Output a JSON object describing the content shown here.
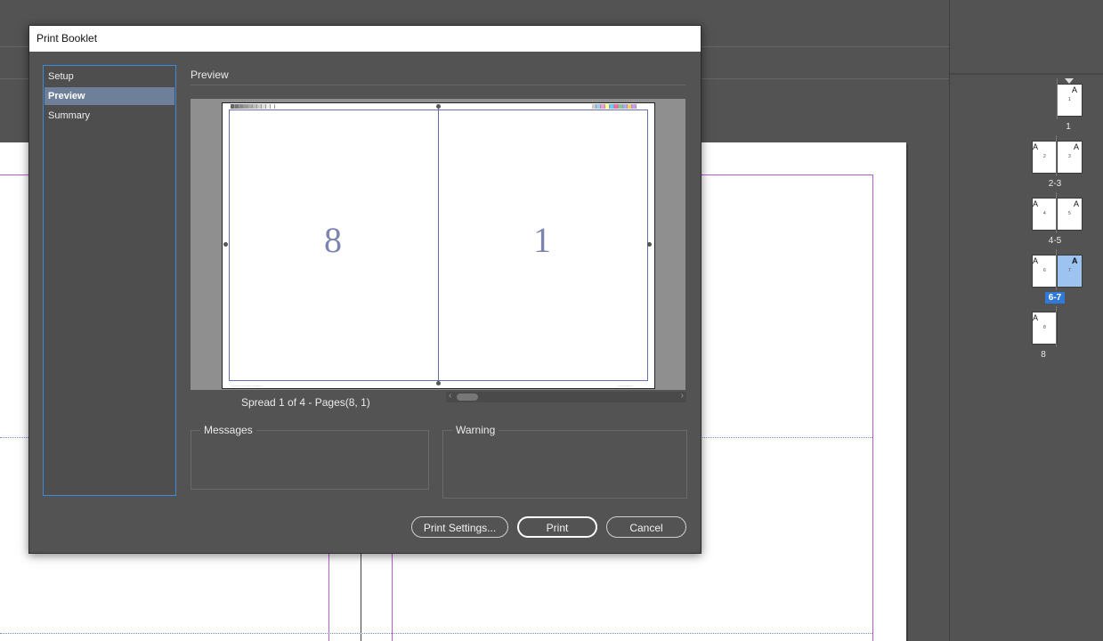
{
  "dialog": {
    "title": "Print Booklet",
    "sidebar": [
      {
        "label": "Setup",
        "selected": false
      },
      {
        "label": "Preview",
        "selected": true
      },
      {
        "label": "Summary",
        "selected": false
      }
    ],
    "section_title": "Preview",
    "preview": {
      "left_page": "8",
      "right_page": "1",
      "spread_info": "Spread 1 of 4 - Pages(8, 1)"
    },
    "messages_label": "Messages",
    "warning_label": "Warning",
    "buttons": {
      "print_settings": "Print Settings...",
      "print": "Print",
      "cancel": "Cancel"
    }
  },
  "pages_panel": {
    "master_letter": "A",
    "spreads": [
      {
        "label": "1",
        "selected": false
      },
      {
        "label": "2-3",
        "selected": false
      },
      {
        "label": "4-5",
        "selected": false
      },
      {
        "label": "6-7",
        "selected": true
      },
      {
        "label": "8",
        "selected": false
      }
    ]
  },
  "colors": {
    "accent": "#2f79d8",
    "dialog_bg": "#535353",
    "selected_sidebar": "#6e7f99",
    "margin_guide": "#b45fd0"
  }
}
